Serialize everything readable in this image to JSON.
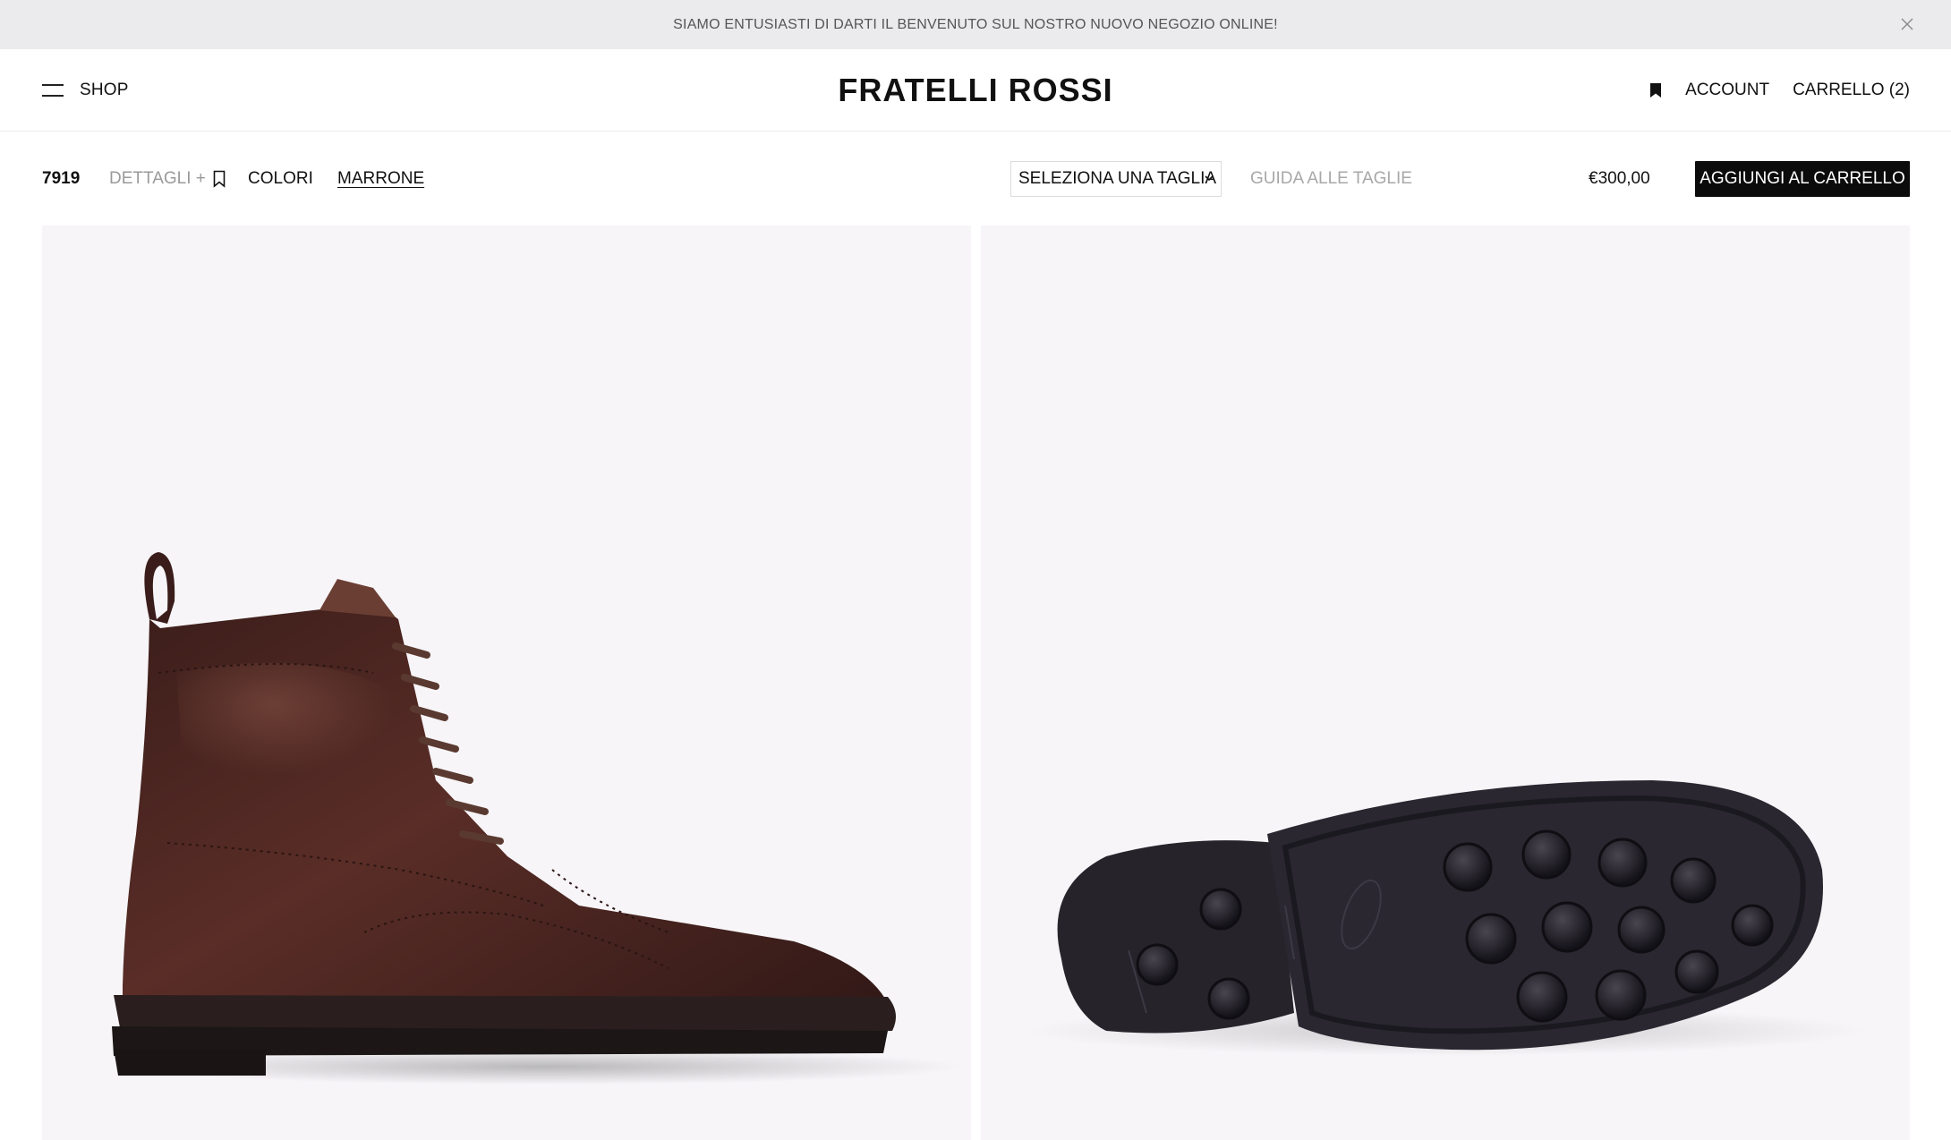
{
  "announcement": {
    "text": "SIAMO ENTUSIASTI DI DARTI IL BENVENUTO SUL NOSTRO NUOVO NEGOZIO ONLINE!",
    "close_icon": "close-icon"
  },
  "header": {
    "menu_label": "SHOP",
    "logo": "FRATELLI ROSSI",
    "account_label": "ACCOUNT",
    "cart_label": "CARRELLO (2)",
    "wishlist_icon": "bookmark-icon"
  },
  "product": {
    "code": "7919",
    "details_label": "DETTAGLI +",
    "colors_label": "COLORI",
    "selected_color": "MARRONE",
    "size_select_value": "SELEZIONA UNA TAGLIA",
    "size_guide_label": "GUIDA ALLE TAGLIE",
    "price": "€300,00",
    "add_to_cart_label": "AGGIUNGI AL CARRELLO"
  },
  "gallery": {
    "images": [
      {
        "name": "boot-side-view",
        "description_icon": "image"
      },
      {
        "name": "boot-sole-view",
        "description_icon": "image"
      }
    ]
  },
  "colors": {
    "announce_bg": "#ebebee",
    "button_bg": "#0b0b0b",
    "panel_bg": "#f7f5f8",
    "leather": "#4a2520",
    "sole": "#2a2730"
  }
}
